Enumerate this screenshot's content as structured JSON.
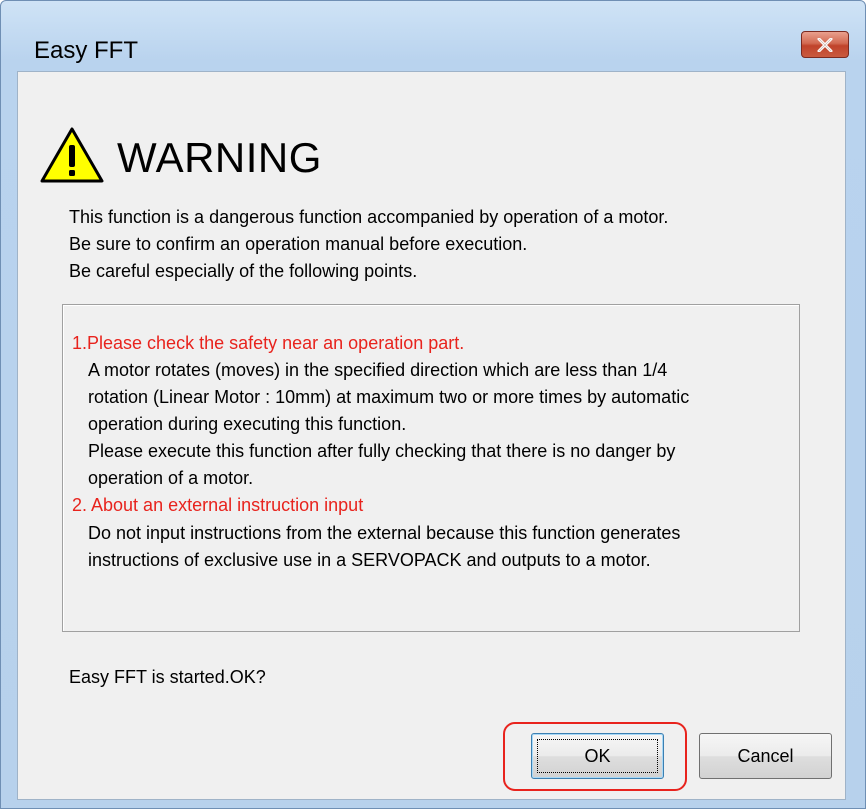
{
  "window": {
    "title": "Easy FFT",
    "close_glyph": "✕"
  },
  "warning": {
    "icon": "warning-triangle-icon",
    "heading": "WARNING",
    "intro_lines": [
      "This function is a dangerous function accompanied by operation of a motor.",
      "Be sure to confirm an operation manual before execution.",
      "Be careful especially of the following points."
    ]
  },
  "points": [
    {
      "heading": "1.Please check the safety near an operation part.",
      "body_lines": [
        "A motor rotates (moves) in the specified direction which are less than 1/4",
        "rotation (Linear Motor : 10mm) at maximum two or more times by automatic",
        "operation during executing this function.",
        "Please execute this function after fully checking that there is no danger by",
        "operation of a motor."
      ]
    },
    {
      "heading": "2. About an external instruction input",
      "body_lines": [
        "Do not input instructions from the external because this function generates",
        "instructions of exclusive use in a SERVOPACK and outputs to a motor."
      ]
    }
  ],
  "confirm_text": "Easy FFT is started.OK?",
  "buttons": {
    "ok_label": "OK",
    "cancel_label": "Cancel"
  },
  "colors": {
    "point_heading": "#e8231d",
    "highlight_ring": "#e8231d",
    "warning_yellow": "#ffff00"
  }
}
